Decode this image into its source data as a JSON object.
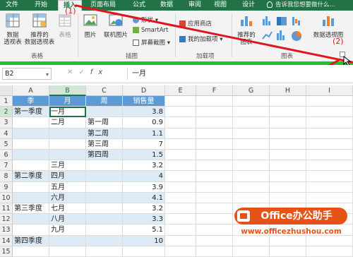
{
  "tabs": [
    "文件",
    "开始",
    "插入",
    "页面布局",
    "公式",
    "数据",
    "审阅",
    "视图",
    "设计"
  ],
  "active_tab": "插入",
  "tell_me": "告诉我您想要做什么...",
  "ribbon": {
    "tables_group": {
      "pivot": "数据\n透视表",
      "recommended_pivot": "推荐的\n数据透视表",
      "table": "表格",
      "label": "表格"
    },
    "illustrations_group": {
      "pictures": "图片",
      "online_pictures": "联机图片",
      "shapes": "形状",
      "smartart": "SmartArt",
      "screenshot": "屏幕截图",
      "label": "插图"
    },
    "addins_group": {
      "store": "应用商店",
      "my_addins": "我的加载项",
      "label": "加载项"
    },
    "charts_group": {
      "recommended_charts": "推荐的\n图表",
      "pivot_chart": "数据透视图",
      "label": "图表"
    }
  },
  "formula_bar": {
    "name_box": "B2",
    "content": "一月"
  },
  "columns": [
    "A",
    "B",
    "C",
    "D",
    "E",
    "F",
    "G",
    "H",
    "I"
  ],
  "rows": [
    "1",
    "2",
    "3",
    "4",
    "5",
    "6",
    "7",
    "8",
    "9",
    "10",
    "11",
    "12",
    "13",
    "14",
    "15"
  ],
  "table": {
    "headers": [
      "季",
      "月",
      "周",
      "销售量"
    ],
    "data": [
      [
        "第一季度",
        "一月",
        "",
        "3.8"
      ],
      [
        "",
        "二月",
        "第一周",
        "0.9"
      ],
      [
        "",
        "",
        "第二周",
        "1.1"
      ],
      [
        "",
        "",
        "第三周",
        "7"
      ],
      [
        "",
        "",
        "第四周",
        "1.5"
      ],
      [
        "",
        "三月",
        "",
        "3.2"
      ],
      [
        "第二季度",
        "四月",
        "",
        "4"
      ],
      [
        "",
        "五月",
        "",
        "3.9"
      ],
      [
        "",
        "六月",
        "",
        "4.1"
      ],
      [
        "第三季度",
        "七月",
        "",
        "3.2"
      ],
      [
        "",
        "八月",
        "",
        "3.3"
      ],
      [
        "",
        "九月",
        "",
        "5.1"
      ],
      [
        "第四季度",
        "",
        "",
        "10"
      ]
    ]
  },
  "annotations": {
    "one": "(1)",
    "two": "(2)"
  },
  "watermark": {
    "brand": "Office办公助手",
    "url": "www.officezhushou.com"
  },
  "colors": {
    "accent": "#217346",
    "header": "#5b9bd5",
    "band": "#ddebf7",
    "annotation": "#e0161e",
    "highlight_bar": "#22c22a"
  }
}
